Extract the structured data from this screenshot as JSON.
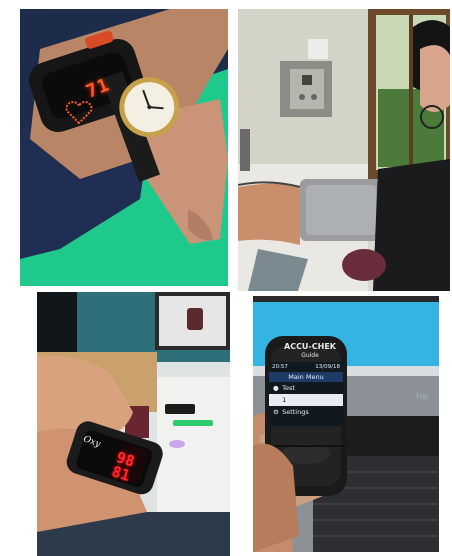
{
  "panels": {
    "wristband": {
      "description_icon": "smart-wristband-and-wristwatch-photo",
      "led_readout": "71"
    },
    "blood_pressure": {
      "description_icon": "blood-pressure-cuff-photo"
    },
    "oximeter": {
      "brand": "Oxy",
      "led_top": "98",
      "led_bottom": "81"
    },
    "glucometer": {
      "brand": "ACCU-CHEK",
      "model": "Guide",
      "time": "20:57",
      "date": "13/09/18",
      "menu_title": "Main Menu",
      "menu_items": [
        {
          "icon": "drop-icon",
          "glyph": "💧",
          "label": "Test"
        },
        {
          "icon": "list-icon",
          "glyph": "",
          "label": "1"
        },
        {
          "icon": "gear-icon",
          "glyph": "⚙",
          "label": "Settings"
        }
      ],
      "laptop_brand": "hp"
    }
  },
  "colors": {
    "green_screen": "#22c98a",
    "led_orange": "#ff5a2a",
    "led_red": "#ff2a2a",
    "desktop_blue": "#2fa9dc"
  }
}
